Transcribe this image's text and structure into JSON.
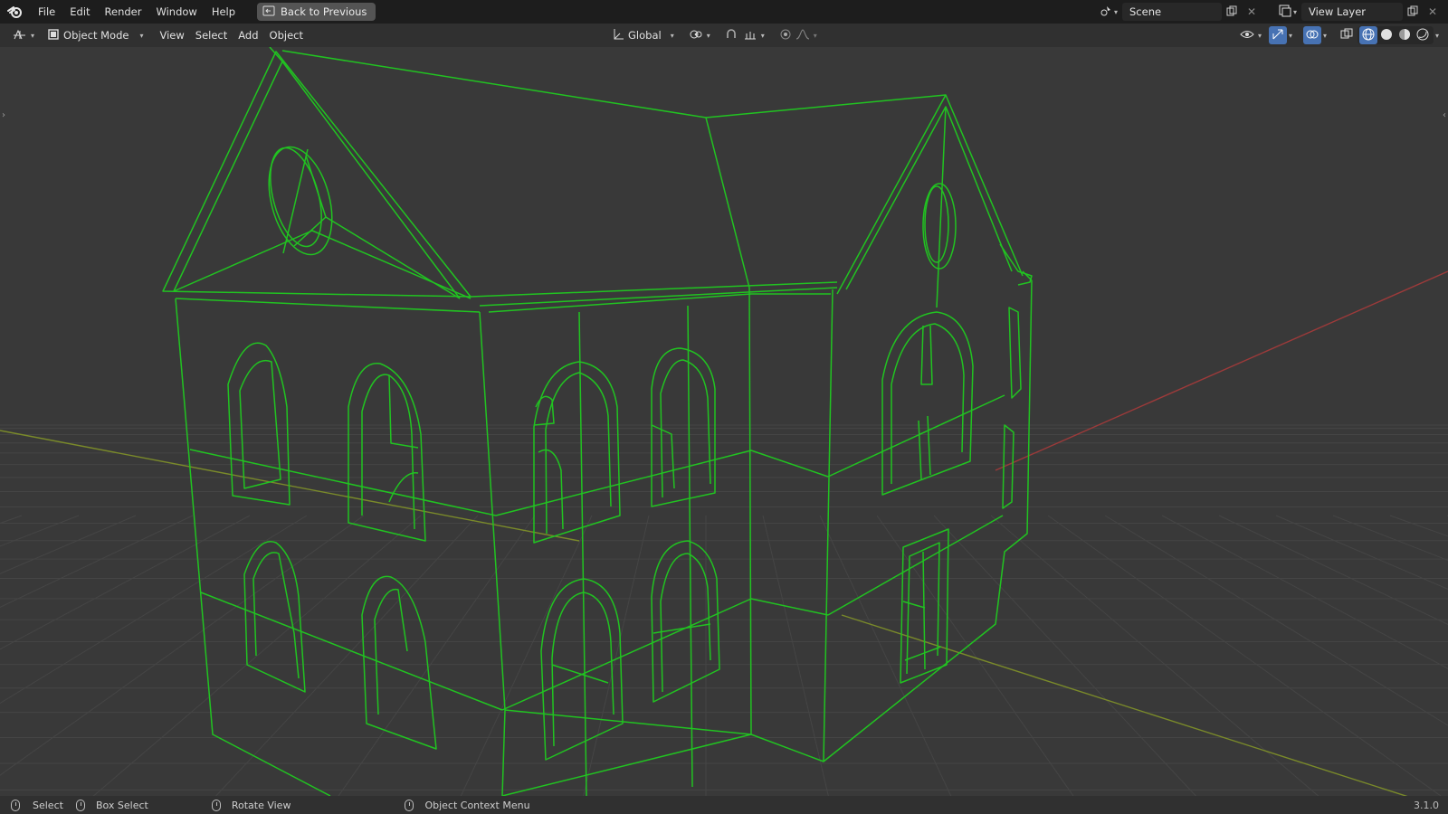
{
  "topbar": {
    "menus": [
      "File",
      "Edit",
      "Render",
      "Window",
      "Help"
    ],
    "back_button": "Back to Previous",
    "scene": "Scene",
    "view_layer": "View Layer"
  },
  "header": {
    "mode": "Object Mode",
    "menus": [
      "View",
      "Select",
      "Add",
      "Object"
    ],
    "orientation": "Global"
  },
  "status": {
    "select": "Select",
    "box_select": "Box Select",
    "rotate_view": "Rotate View",
    "context_menu": "Object Context Menu",
    "version": "3.1.0"
  },
  "colors": {
    "wire": "#21c321",
    "grid": "#444444",
    "x_axis": "#9c3a3a",
    "y_axis": "#7a8a2a"
  },
  "icons": {
    "logo": "blender-logo-icon",
    "back": "back-arrow-icon",
    "scene": "scene-icon",
    "view_layer": "view-layer-icon",
    "editor": "editor-type-icon",
    "mode": "object-mode-icon",
    "orientation": "transform-orientation-icon",
    "pivot": "pivot-point-icon",
    "snap": "snap-icon",
    "proportional": "proportional-edit-icon",
    "visibility": "visibility-icon",
    "gizmo": "gizmo-icon",
    "overlay": "overlay-icon",
    "xray": "xray-icon",
    "shading": [
      "wireframe-shading-icon",
      "solid-shading-icon",
      "material-shading-icon",
      "rendered-shading-icon"
    ]
  }
}
